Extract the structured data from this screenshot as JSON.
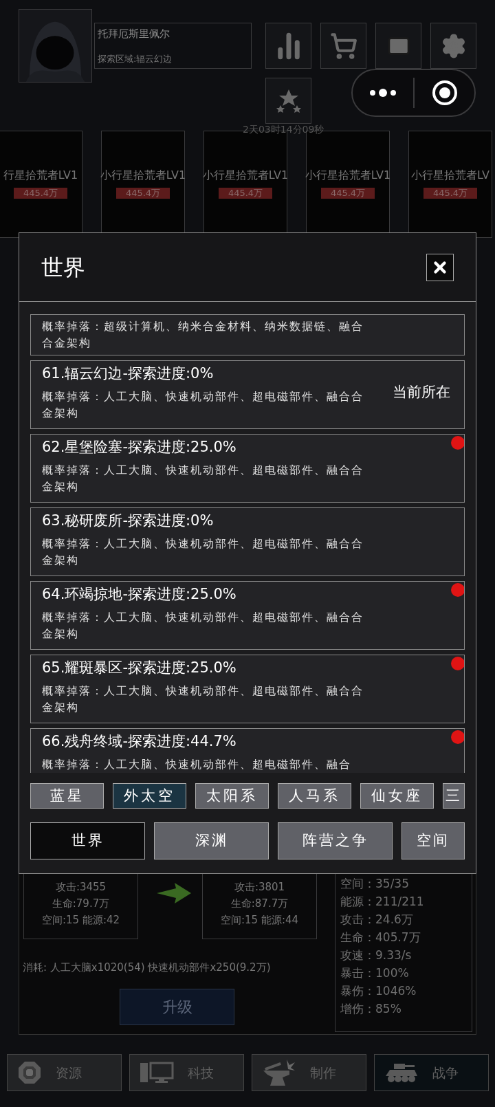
{
  "player": {
    "name": "托拜厄斯里佩尔",
    "area": "探索区域:辐云幻边"
  },
  "timer": "2天03时14分09秒",
  "enemy_cards": [
    {
      "name": "行星拾荒者LV1",
      "value": "445.4万"
    },
    {
      "name": "小行星拾荒者LV1",
      "value": "445.4万"
    },
    {
      "name": "小行星拾荒者LV1",
      "value": "445.4万"
    },
    {
      "name": "小行星拾荒者LV1",
      "value": "445.4万"
    },
    {
      "name": "小行星拾荒者LV",
      "value": "445.4万"
    }
  ],
  "dialog": {
    "title": "世界",
    "zones": [
      {
        "drops": "概率掉落：超级计算机、纳米合金材料、纳米数据链、融合合金架构",
        "alert": false
      },
      {
        "title": "61.辐云幻边-探索进度:0%",
        "drops": "概率掉落：人工大脑、快速机动部件、超电磁部件、融合合金架构",
        "status": "当前所在",
        "alert": false
      },
      {
        "title": "62.星堡险塞-探索进度:25.0%",
        "drops": "概率掉落：人工大脑、快速机动部件、超电磁部件、融合合金架构",
        "alert": true
      },
      {
        "title": "63.秘研废所-探索进度:0%",
        "drops": "概率掉落：人工大脑、快速机动部件、超电磁部件、融合合金架构",
        "alert": false
      },
      {
        "title": "64.环竭掠地-探索进度:25.0%",
        "drops": "概率掉落：人工大脑、快速机动部件、超电磁部件、融合合金架构",
        "alert": true
      },
      {
        "title": "65.耀斑暴区-探索进度:25.0%",
        "drops": "概率掉落：人工大脑、快速机动部件、超电磁部件、融合合金架构",
        "alert": true
      },
      {
        "title": "66.残舟终域-探索进度:44.7%",
        "drops": "概率掉落：人工大脑、快速机动部件、超电磁部件、融合",
        "alert": true
      }
    ],
    "regions": [
      {
        "label": "蓝星",
        "selected": false
      },
      {
        "label": "外太空",
        "selected": true
      },
      {
        "label": "太阳系",
        "selected": false
      },
      {
        "label": "人马系",
        "selected": false
      },
      {
        "label": "仙女座",
        "selected": false
      },
      {
        "label": "三",
        "selected": false
      }
    ],
    "categories": [
      {
        "label": "世界",
        "selected": true
      },
      {
        "label": "深渊",
        "selected": false
      },
      {
        "label": "阵营之争",
        "selected": false
      },
      {
        "label": "空间",
        "selected": false
      }
    ]
  },
  "upgrade": {
    "before": [
      "攻击:3455",
      "生命:79.7万",
      "空间:15 能源:42"
    ],
    "after": [
      "攻击:3801",
      "生命:87.7万",
      "空间:15 能源:44"
    ],
    "cost": "消耗: 人工大脑x1020(54) 快速机动部件x250(9.2万)",
    "button": "升级"
  },
  "stats": [
    {
      "label": "空间：",
      "value": "35/35"
    },
    {
      "label": "能源：",
      "value": "211/211"
    },
    {
      "label": "攻击：",
      "value": "24.6万"
    },
    {
      "label": "生命：",
      "value": "405.7万"
    },
    {
      "label": "攻速：",
      "value": "9.33/s"
    },
    {
      "label": "暴击：",
      "value": "100%"
    },
    {
      "label": "暴伤：",
      "value": "1046%"
    },
    {
      "label": "增伤：",
      "value": "85%"
    }
  ],
  "nav": [
    {
      "label": "资源",
      "kind": "gem",
      "selected": false
    },
    {
      "label": "科技",
      "kind": "computer",
      "selected": false
    },
    {
      "label": "制作",
      "kind": "anvil",
      "selected": false
    },
    {
      "label": "战争",
      "kind": "tank",
      "selected": true
    }
  ]
}
